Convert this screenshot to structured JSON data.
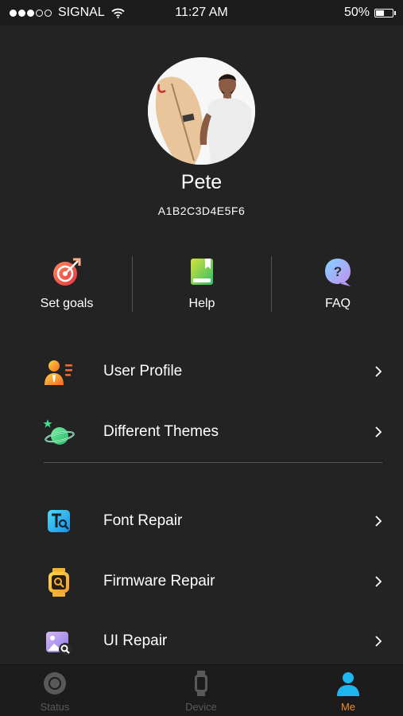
{
  "status_bar": {
    "carrier": "SIGNAL",
    "time": "11:27 AM",
    "battery": "50%",
    "battery_level": 0.5,
    "signal_bars_filled": 3,
    "signal_bars_total": 5
  },
  "profile": {
    "name": "Pete",
    "device_id": "A1B2C3D4E5F6"
  },
  "quick_actions": [
    {
      "label": "Set goals",
      "icon": "target-icon"
    },
    {
      "label": "Help",
      "icon": "book-icon"
    },
    {
      "label": "FAQ",
      "icon": "question-bubble-icon"
    }
  ],
  "menu": {
    "group1": [
      {
        "label": "User Profile",
        "icon": "user-profile-icon"
      },
      {
        "label": "Different Themes",
        "icon": "planet-icon"
      }
    ],
    "group2": [
      {
        "label": "Font Repair",
        "icon": "font-repair-icon"
      },
      {
        "label": "Firmware Repair",
        "icon": "watch-repair-icon"
      },
      {
        "label": "UI Repair",
        "icon": "image-repair-icon"
      }
    ]
  },
  "tabs": [
    {
      "label": "Status",
      "icon": "status-icon",
      "active": false
    },
    {
      "label": "Device",
      "icon": "watch-icon",
      "active": false
    },
    {
      "label": "Me",
      "icon": "person-icon",
      "active": true
    }
  ],
  "colors": {
    "background": "#232323",
    "active_tab": "#f18a2e",
    "inactive_tab": "#595959",
    "tab_icon_active": "#1fb6f0"
  }
}
